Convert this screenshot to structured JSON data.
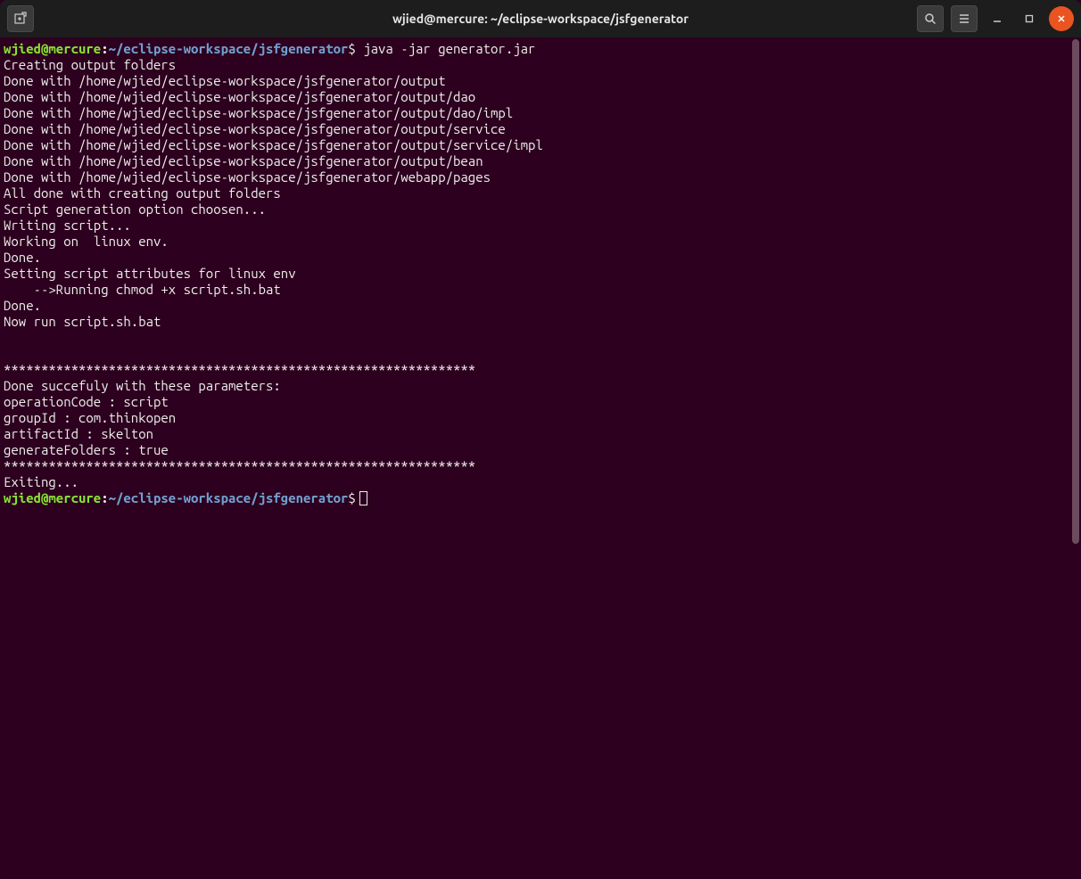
{
  "window": {
    "title": "wjied@mercure: ~/eclipse-workspace/jsfgenerator"
  },
  "prompt": {
    "user_host": "wjied@mercure",
    "path": "~/eclipse-workspace/jsfgenerator",
    "symbol": "$"
  },
  "command": " java -jar generator.jar",
  "output_lines": [
    "Creating output folders",
    "Done with /home/wjied/eclipse-workspace/jsfgenerator/output",
    "Done with /home/wjied/eclipse-workspace/jsfgenerator/output/dao",
    "Done with /home/wjied/eclipse-workspace/jsfgenerator/output/dao/impl",
    "Done with /home/wjied/eclipse-workspace/jsfgenerator/output/service",
    "Done with /home/wjied/eclipse-workspace/jsfgenerator/output/service/impl",
    "Done with /home/wjied/eclipse-workspace/jsfgenerator/output/bean",
    "Done with /home/wjied/eclipse-workspace/jsfgenerator/webapp/pages",
    "All done with creating output folders",
    "Script generation option choosen...",
    "Writing script...",
    "Working on  linux env.",
    "Done.",
    "Setting script attributes for linux env",
    "    -->Running chmod +x script.sh.bat",
    "Done.",
    "Now run script.sh.bat",
    "",
    "",
    "***************************************************************",
    "Done succefuly with these parameters:",
    "operationCode : script",
    "groupId : com.thinkopen",
    "artifactId : skelton",
    "generateFolders : true",
    "***************************************************************",
    "Exiting..."
  ]
}
